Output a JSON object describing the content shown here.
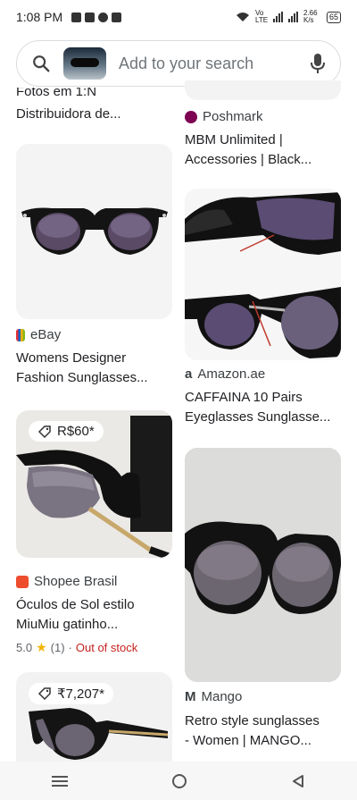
{
  "status": {
    "time": "1:08 PM",
    "network": "Vo LTE",
    "speed": "2.66 K/s",
    "battery": "65"
  },
  "search": {
    "placeholder": "Add to your search"
  },
  "left_column": [
    {
      "title_line1": "Fotos em 1:N",
      "title_line2": "Distribuidora de..."
    },
    {
      "source": "eBay",
      "title_line1": "Womens Designer",
      "title_line2": "Fashion Sunglasses..."
    },
    {
      "price": "R$60*",
      "source": "Shopee Brasil",
      "title_line1": "Óculos de Sol estilo",
      "title_line2": "MiuMiu gatinho...",
      "rating": "5.0",
      "rating_count": "(1)",
      "stock": "Out of stock"
    },
    {
      "price": "₹7,207*"
    }
  ],
  "right_column": [
    {
      "source": "Poshmark",
      "title_line1": "MBM Unlimited |",
      "title_line2": "Accessories | Black..."
    },
    {
      "source": "Amazon.ae",
      "title_line1": "CAFFAINA 10 Pairs",
      "title_line2": "Eyeglasses Sunglasse..."
    },
    {
      "source": "Mango",
      "title_line1": "Retro style sunglasses",
      "title_line2": "- Women | MANGO..."
    }
  ],
  "icons": {
    "search": "search-icon",
    "mic": "mic-icon",
    "tag": "tag-icon",
    "star": "star-icon",
    "nav_menu": "menu-icon",
    "nav_home": "home-circle-icon",
    "nav_back": "back-triangle-icon"
  },
  "colors": {
    "accent_star": "#f4b400",
    "out_of_stock": "#c5221f",
    "poshmark": "#7f0353",
    "shopee": "#ee4d2d",
    "ebay": "#e53238"
  }
}
